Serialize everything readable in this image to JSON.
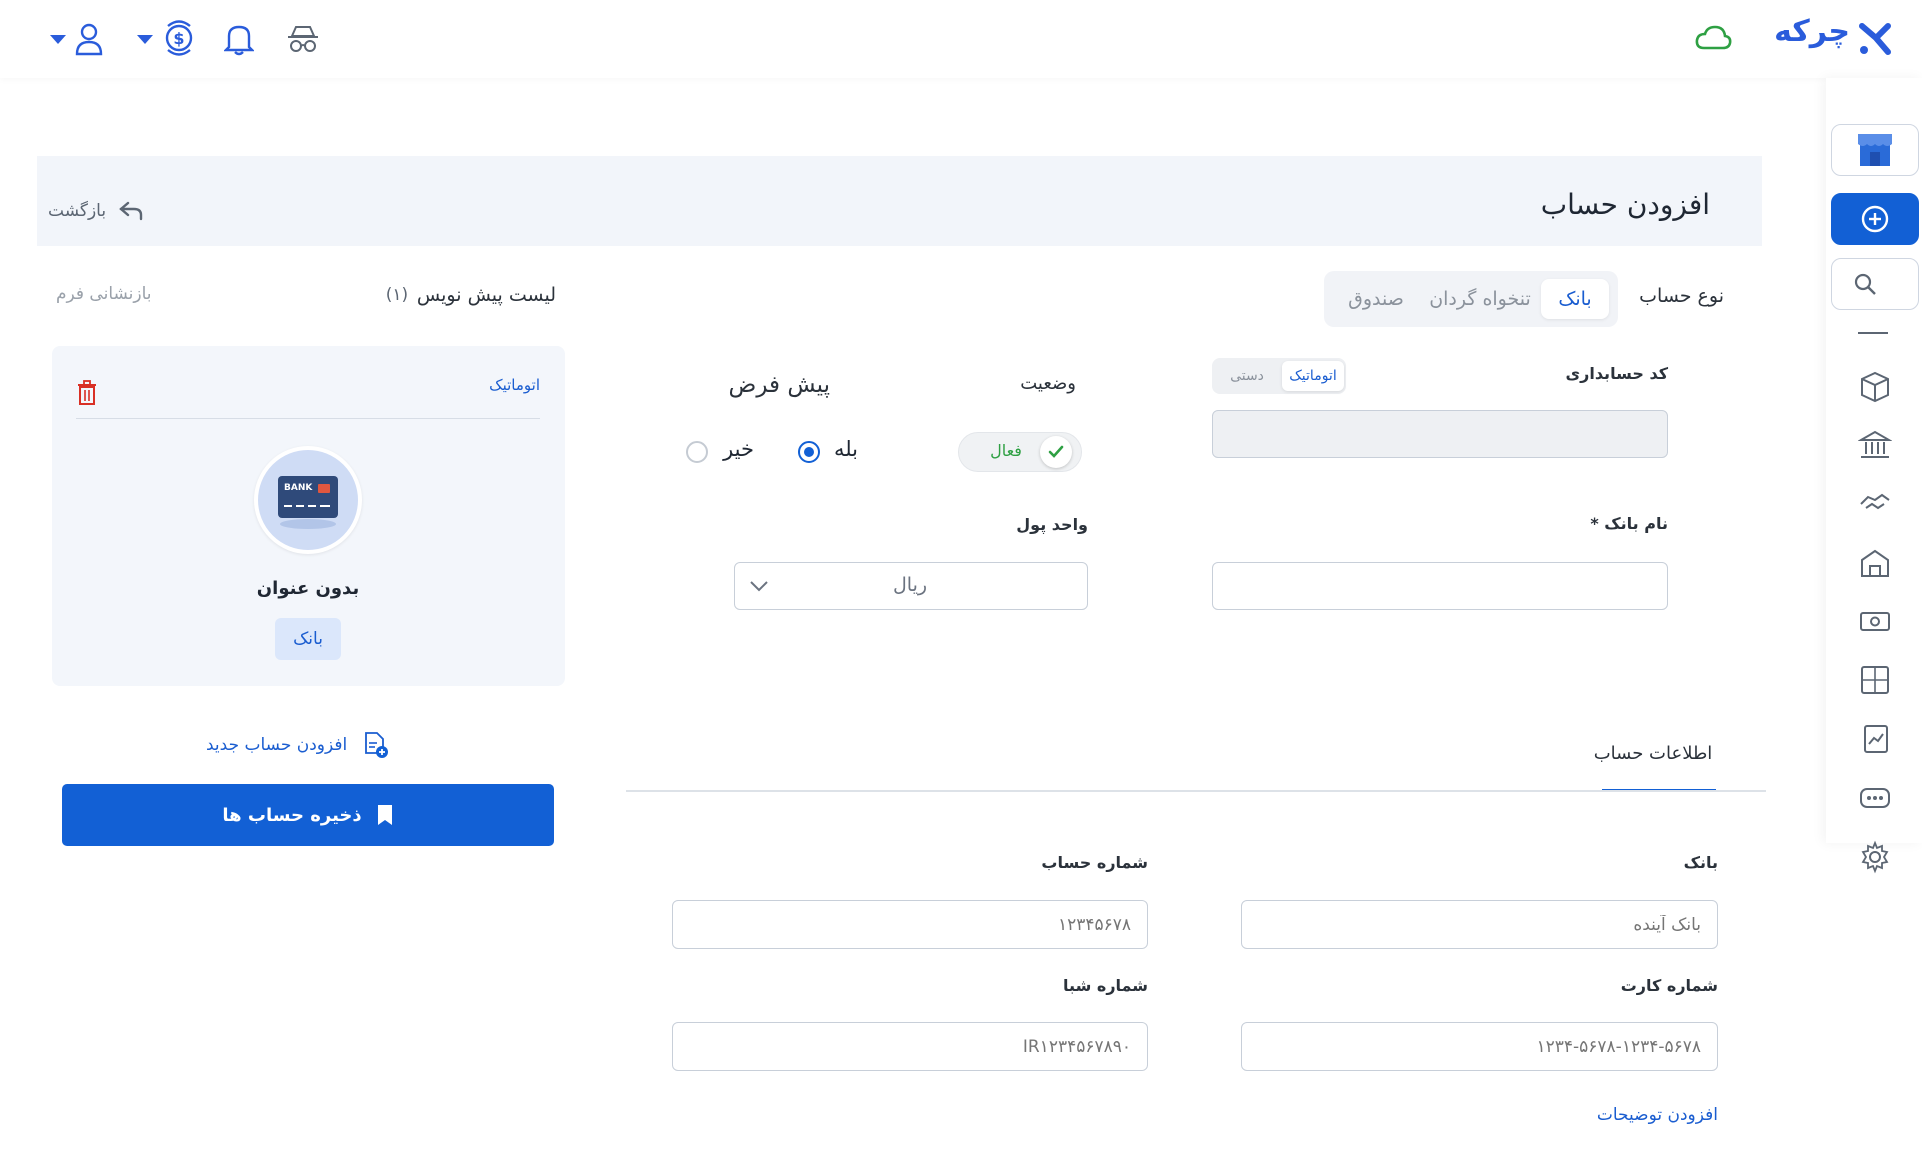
{
  "app": {
    "logo_text": "چرکه"
  },
  "header": {
    "title": "افزودن حساب",
    "back_label": "بازگشت"
  },
  "account_type": {
    "label": "نوع حساب",
    "options": [
      "بانک",
      "تنخواه گردان",
      "صندوق"
    ],
    "selected": "بانک"
  },
  "accounting_code": {
    "label": "کد حسابداری",
    "modes": [
      "اتوماتیک",
      "دستی"
    ],
    "selected": "اتوماتیک",
    "value": ""
  },
  "status": {
    "label": "وضعیت",
    "value": "فعال"
  },
  "default": {
    "label": "پیش فرض",
    "yes": "بله",
    "no": "خیر",
    "selected": "بله"
  },
  "bank_name": {
    "label": "نام بانک *",
    "value": ""
  },
  "currency": {
    "label": "واحد پول",
    "value": "ریال"
  },
  "info_tab": {
    "label": "اطلاعات حساب"
  },
  "fields": {
    "bank": {
      "label": "بانک",
      "placeholder": "بانک آینده"
    },
    "account_number": {
      "label": "شماره حساب",
      "placeholder": "۱۲۳۴۵۶۷۸"
    },
    "card_number": {
      "label": "شماره کارت",
      "placeholder": "۱۲۳۴-۵۶۷۸-۱۲۳۴-۵۶۷۸"
    },
    "sheba": {
      "label": "شماره شبا",
      "placeholder": "IR۱۲۳۴۵۶۷۸۹۰"
    }
  },
  "add_notes": "افزودن توضیحات",
  "drafts": {
    "title": "لیست پیش نویس",
    "count": "(۱)",
    "reset": "بازنشانی فرم",
    "card": {
      "mode": "اتوماتیک",
      "name": "بدون عنوان",
      "type": "بانک",
      "bank_card_text": "BANK"
    },
    "add_new": "افزودن حساب جدید",
    "save": "ذخیره حساب ها"
  },
  "colors": {
    "primary": "#1260d5",
    "link": "#1a5dd0",
    "success": "#2ea043",
    "danger": "#d93025"
  }
}
